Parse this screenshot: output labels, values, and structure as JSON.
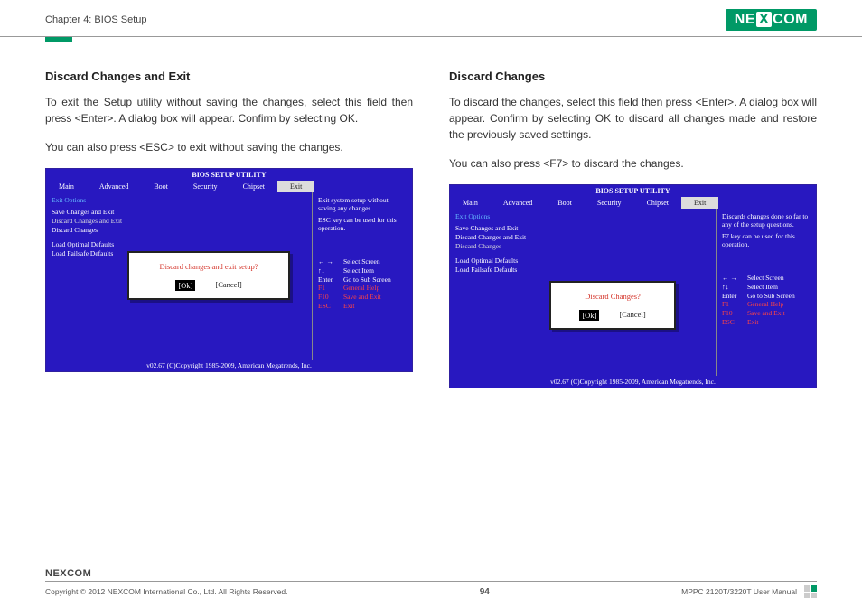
{
  "header": {
    "chapter": "Chapter 4: BIOS Setup",
    "brand": "NEXCOM"
  },
  "left": {
    "title": "Discard Changes and Exit",
    "p1": "To exit the Setup utility without saving the changes, select this field then press <Enter>. A dialog box will appear. Confirm by selecting OK.",
    "p2": "You can also press <ESC> to exit without saving the changes."
  },
  "right": {
    "title": "Discard Changes",
    "p1": "To discard the changes, select this field then press <Enter>. A dialog box will appear. Confirm by selecting OK to discard all changes made and restore the previously saved settings.",
    "p2": "You can also press <F7> to discard the changes."
  },
  "bios": {
    "title": "BIOS SETUP UTILITY",
    "tabs": [
      "Main",
      "Advanced",
      "Boot",
      "Security",
      "Chipset",
      "Exit"
    ],
    "active_tab": "Exit",
    "opt_head": "Exit Options",
    "opts": [
      "Save Changes and Exit",
      "Discard Changes and Exit",
      "Discard Changes"
    ],
    "opts2": [
      "Load Optimal Defaults",
      "Load Failsafe Defaults"
    ],
    "help1_a": "Exit system setup without saving any changes.",
    "help1_b": "ESC key can be used for this operation.",
    "help2_a": "Discards changes done so far to any of the setup questions.",
    "help2_b": "F7 key can be used for this operation.",
    "keys": [
      {
        "k": "← →",
        "d": "Select Screen"
      },
      {
        "k": "↑↓",
        "d": "Select Item"
      },
      {
        "k": "Enter",
        "d": "Go to Sub Screen"
      },
      {
        "k": "F1",
        "d": "General Help"
      },
      {
        "k": "F10",
        "d": "Save and Exit"
      },
      {
        "k": "ESC",
        "d": "Exit"
      }
    ],
    "footer": "v02.67 (C)Copyright 1985-2009, American Megatrends, Inc.",
    "dialog1": {
      "text": "Discard changes and exit setup?",
      "ok": "[Ok]",
      "cancel": "[Cancel]"
    },
    "dialog2": {
      "text": "Discard Changes?",
      "ok": "[Ok]",
      "cancel": "[Cancel]"
    }
  },
  "footer": {
    "brand": "NEXCOM",
    "copyright": "Copyright © 2012 NEXCOM International Co., Ltd. All Rights Reserved.",
    "page": "94",
    "manual": "MPPC 2120T/3220T User Manual"
  }
}
